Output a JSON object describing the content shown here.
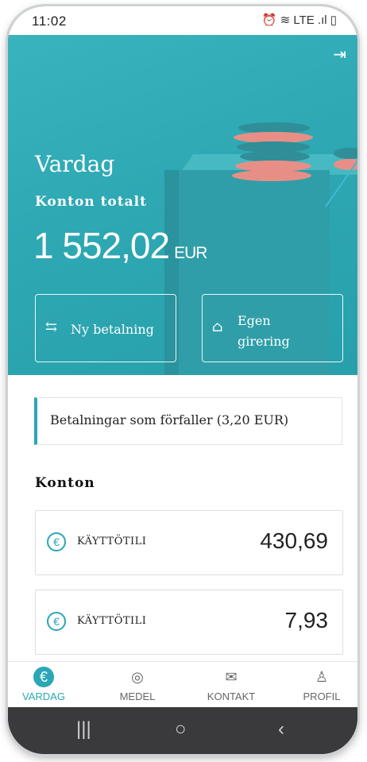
{
  "status": {
    "time": "11:02",
    "icons": "⏰ ≋ LTE .ıl ▯"
  },
  "hero": {
    "title": "Vardag",
    "subtitle": "Konton totalt",
    "amount": "1 552,02",
    "currency": "EUR",
    "logout_icon": "logout-icon",
    "actions": [
      {
        "label": "Ny betalning",
        "icon": "⇆"
      },
      {
        "label_line1": "Egen",
        "label_line2": "girering",
        "icon": "⌂"
      }
    ]
  },
  "notice": {
    "text": "Betalningar som förfaller (3,20 EUR)"
  },
  "accounts": {
    "heading": "Konton",
    "items": [
      {
        "name": "KÄYTTÖTILI",
        "value": "430,69",
        "icon": "€"
      },
      {
        "name": "KÄYTTÖTILI",
        "value": "7,93",
        "icon": "€"
      }
    ]
  },
  "nav": {
    "items": [
      {
        "label": "VARDAG",
        "icon": "€"
      },
      {
        "label": "MEDEL",
        "icon": "◎"
      },
      {
        "label": "KONTAKT",
        "icon": "✉"
      },
      {
        "label": "PROFIL",
        "icon": "♙"
      }
    ]
  },
  "system_nav": {
    "recent": "|||",
    "home": "○",
    "back": "‹"
  },
  "colors": {
    "accent": "#2aa7b4",
    "hero": "#33aeb8",
    "coin_pink": "#e78f86"
  }
}
